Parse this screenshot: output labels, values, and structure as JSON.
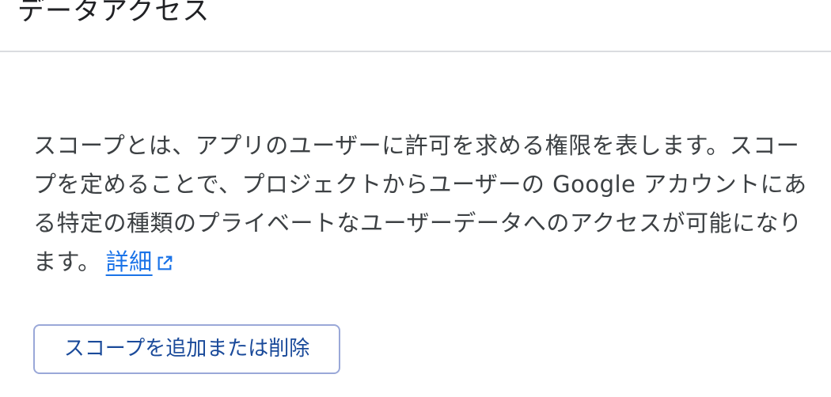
{
  "header": {
    "title": "データアクセス"
  },
  "main": {
    "description": "スコープとは、アプリのユーザーに許可を求める権限を表します。スコープを定めることで、プロジェクトからユーザーの Google アカウントにある特定の種類のプライベートなユーザーデータへのアクセスが可能になります。",
    "learn_more_label": "詳細",
    "learn_more_icon": "open-in-new-icon",
    "scope_button_label": "スコープを追加または削除"
  },
  "colors": {
    "link": "#1a73e8",
    "button_text": "#1a4a9a",
    "button_border": "#9aa8d8",
    "divider": "#dadce0"
  }
}
